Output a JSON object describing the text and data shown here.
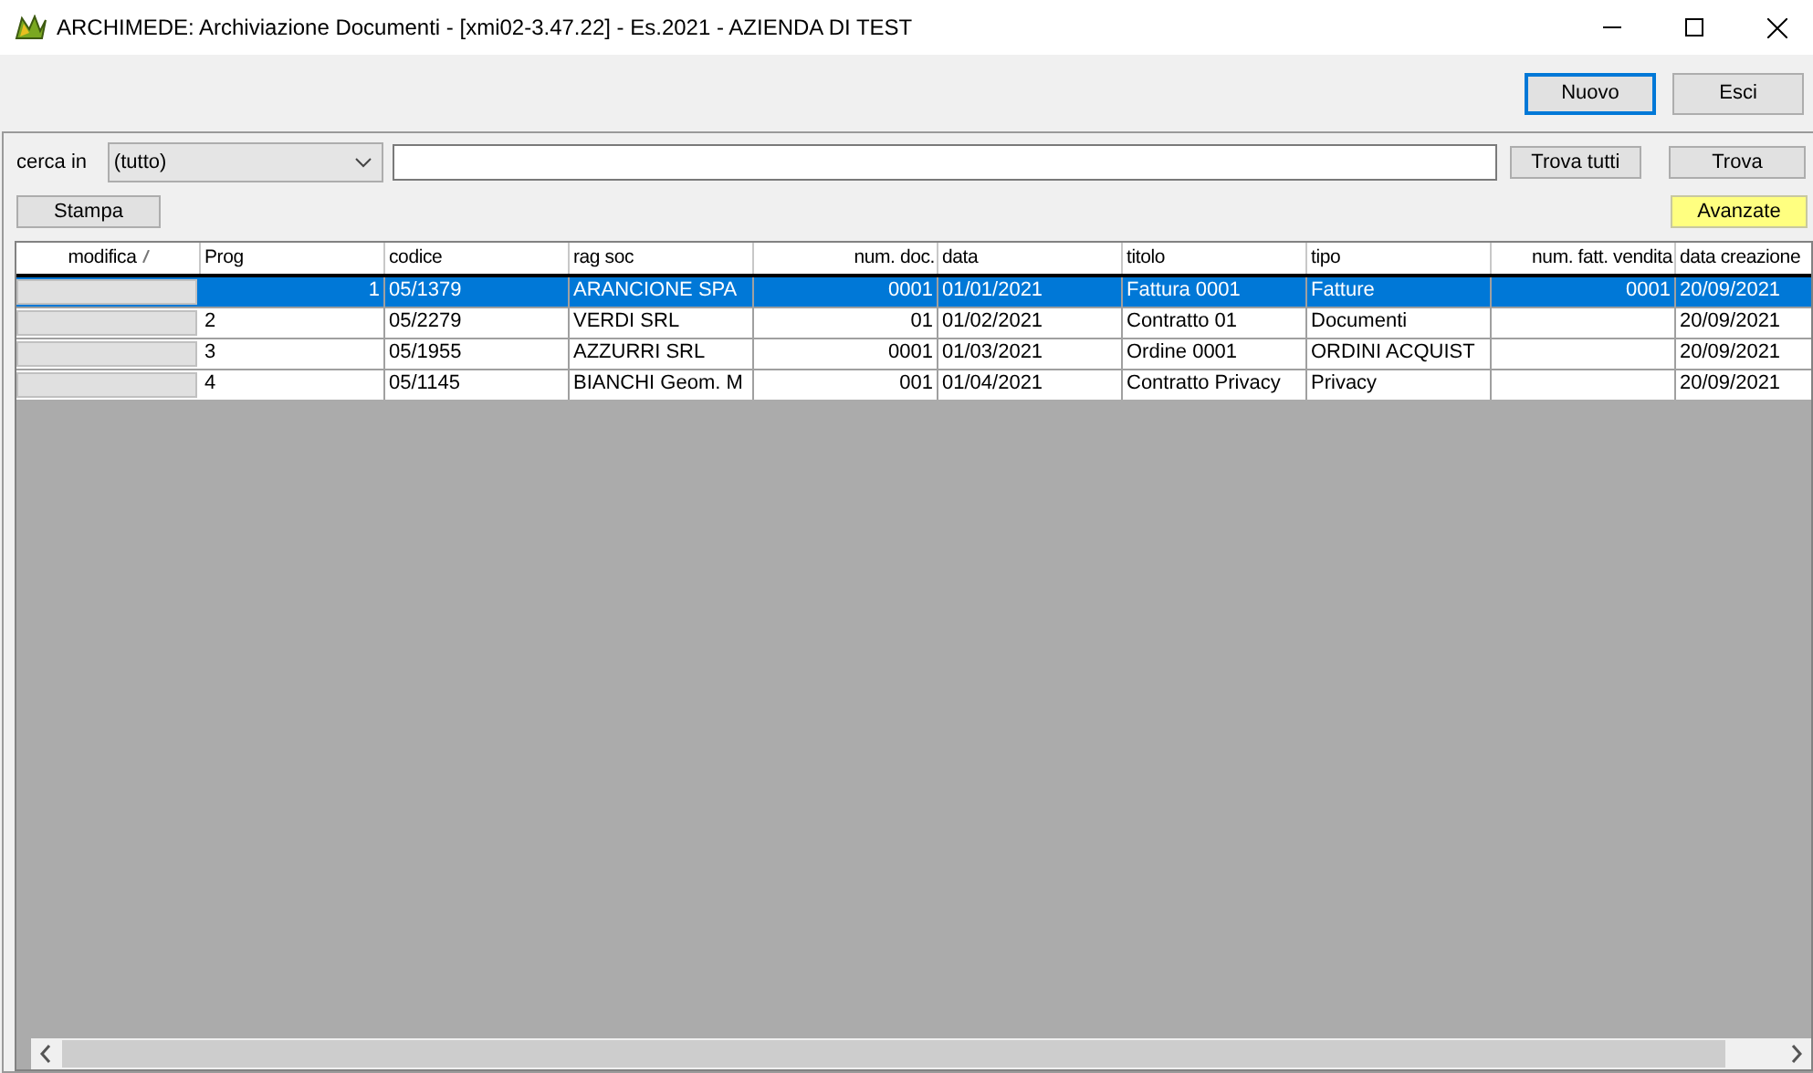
{
  "window": {
    "title": "ARCHIMEDE: Archiviazione Documenti - [xmi02-3.47.22] - Es.2021 - AZIENDA DI TEST"
  },
  "toolbar": {
    "buttons": [
      {
        "label": "Nuovo",
        "default": true
      },
      {
        "label": "Esci",
        "default": false
      }
    ]
  },
  "search": {
    "label": "cerca in",
    "scope": "(tutto)",
    "find_all": "Trova tutti",
    "find": "Trova"
  },
  "actions": {
    "print": "Stampa",
    "advanced": "Avanzate"
  },
  "table": {
    "columns": [
      {
        "label": "modifica",
        "kind": "edit",
        "sorted": true
      },
      {
        "label": "Prog",
        "kind": "text"
      },
      {
        "label": "codice",
        "kind": "text"
      },
      {
        "label": "rag soc",
        "kind": "text"
      },
      {
        "label": "num. doc.",
        "kind": "number"
      },
      {
        "label": "data",
        "kind": "text"
      },
      {
        "label": "titolo",
        "kind": "text"
      },
      {
        "label": "tipo",
        "kind": "text"
      },
      {
        "label": "num. fatt. vendita",
        "kind": "number"
      },
      {
        "label": "data creazione",
        "kind": "text"
      }
    ],
    "rows": [
      {
        "selected": true,
        "cells": [
          "",
          "1",
          "05/1379",
          "ARANCIONE SPA",
          "0001",
          "01/01/2021",
          "Fattura 0001",
          "Fatture",
          "0001",
          "20/09/2021"
        ]
      },
      {
        "selected": false,
        "cells": [
          "",
          "2",
          "05/2279",
          "VERDI SRL",
          "01",
          "01/02/2021",
          "Contratto 01",
          "Documenti",
          "",
          "20/09/2021"
        ]
      },
      {
        "selected": false,
        "cells": [
          "",
          "3",
          "05/1955",
          "AZZURRI SRL",
          "0001",
          "01/03/2021",
          "Ordine 0001",
          "ORDINI ACQUIST",
          "",
          "20/09/2021"
        ]
      },
      {
        "selected": false,
        "cells": [
          "",
          "4",
          "05/1145",
          "BIANCHI Geom. M",
          "001",
          "01/04/2021",
          "Contratto Privacy",
          "Privacy",
          "",
          "20/09/2021"
        ]
      }
    ]
  }
}
